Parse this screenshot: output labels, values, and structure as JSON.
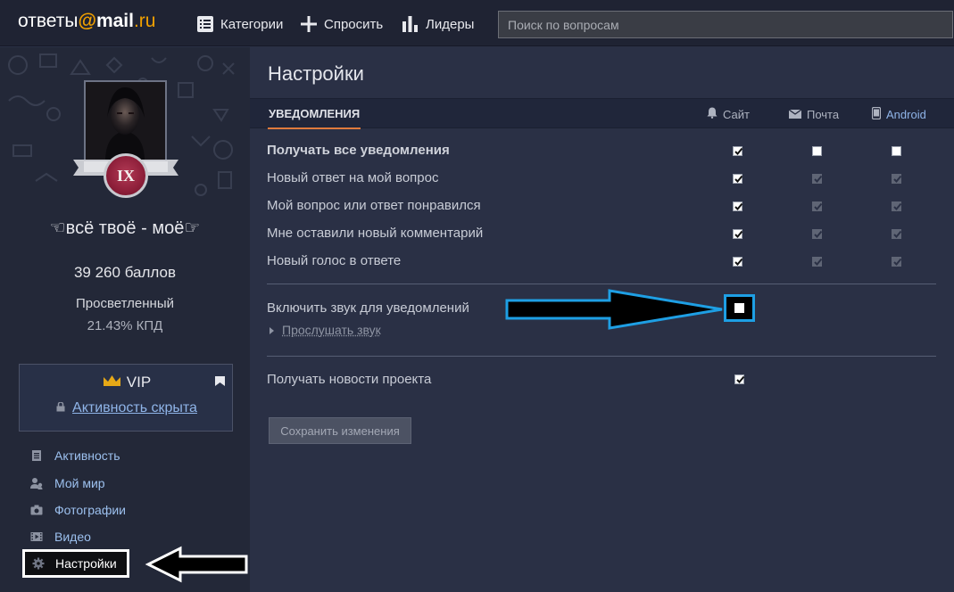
{
  "topbar": {
    "logo_prefix": "ответы",
    "logo_at": "@",
    "logo_mail": "mail",
    "logo_ru": ".ru",
    "nav": [
      {
        "label": "Категории",
        "icon": "list-icon"
      },
      {
        "label": "Спросить",
        "icon": "plus-icon"
      },
      {
        "label": "Лидеры",
        "icon": "bar-chart-icon"
      }
    ],
    "search_placeholder": "Поиск по вопросам"
  },
  "profile": {
    "rank_numeral": "IX",
    "username": "☜всё твоё - моё☞",
    "points": "39 260 баллов",
    "rank_title": "Просветленный",
    "kpd": "21.43% КПД",
    "vip_label": "VIP",
    "vip_activity": "Активность скрыта"
  },
  "sidebar": {
    "items": [
      {
        "label": "Активность",
        "icon": "document-icon"
      },
      {
        "label": "Мой мир",
        "icon": "people-icon"
      },
      {
        "label": "Фотографии",
        "icon": "camera-icon"
      },
      {
        "label": "Видео",
        "icon": "film-icon"
      },
      {
        "label": "Настройки",
        "icon": "gear-icon"
      }
    ]
  },
  "settings": {
    "title": "Настройки",
    "tab": "УВЕДОМЛЕНИЯ",
    "columns": [
      {
        "label": "Сайт",
        "icon": "bell-icon"
      },
      {
        "label": "Почта",
        "icon": "envelope-icon"
      },
      {
        "label": "Android",
        "icon": "phone-icon"
      }
    ],
    "rows": [
      {
        "label": "Получать все уведомления",
        "bold": true,
        "site": true,
        "mail": false,
        "android": false,
        "mail_dim": false,
        "android_dim": false
      },
      {
        "label": "Новый ответ на мой вопрос",
        "bold": false,
        "site": true,
        "mail": true,
        "android": true,
        "mail_dim": true,
        "android_dim": true
      },
      {
        "label": "Мой вопрос или ответ понравился",
        "bold": false,
        "site": true,
        "mail": true,
        "android": true,
        "mail_dim": true,
        "android_dim": true
      },
      {
        "label": "Мне оставили новый комментарий",
        "bold": false,
        "site": true,
        "mail": true,
        "android": true,
        "mail_dim": true,
        "android_dim": true
      },
      {
        "label": "Новый голос в ответе",
        "bold": false,
        "site": true,
        "mail": true,
        "android": true,
        "mail_dim": true,
        "android_dim": true
      }
    ],
    "sound_label": "Включить звук для уведомлений",
    "sound_checked": false,
    "listen_label": "Прослушать звук",
    "news_label": "Получать новости проекта",
    "news_checked": true,
    "save_label": "Сохранить изменения"
  },
  "colors": {
    "accent_orange": "#e07a3c",
    "link_blue": "#8fb4e8",
    "highlight_blue": "#1e9fe4",
    "vip_gold": "#e6a817"
  }
}
